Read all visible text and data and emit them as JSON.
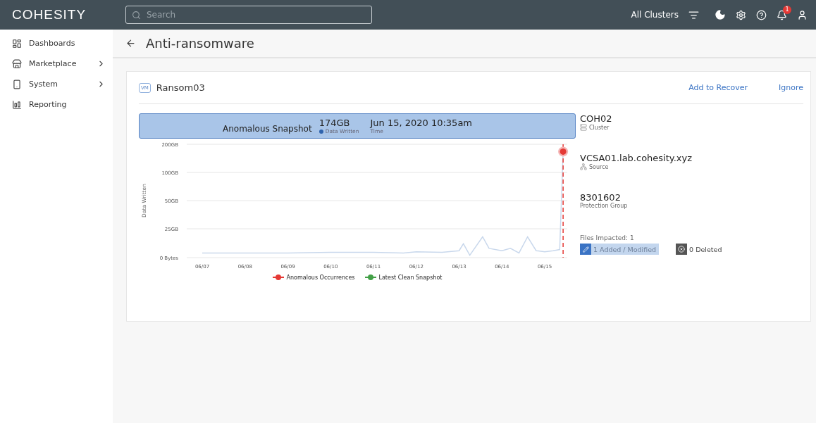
{
  "top_bar": {
    "logo": "COHESITY",
    "search": {
      "placeholder": "Search"
    },
    "cluster_filter": "All Clusters",
    "notification_count": "1"
  },
  "sidebar": {
    "items": [
      {
        "label": "Dashboards",
        "has_submenu": false
      },
      {
        "label": "Marketplace",
        "has_submenu": true
      },
      {
        "label": "System",
        "has_submenu": true
      },
      {
        "label": "Reporting",
        "has_submenu": false
      }
    ]
  },
  "page": {
    "title": "Anti-ransomware"
  },
  "card": {
    "object_type": "VM",
    "object_name": "Ransom03",
    "actions": [
      "Add to Recover",
      "Ignore"
    ],
    "banner": {
      "title": "Anomalous Snapshot",
      "data_written": "174GB",
      "data_written_label": "Data Written",
      "time": "Jun 15, 2020 10:35am",
      "time_label": "Time"
    },
    "chart": {
      "ylabel": "Data Written",
      "y_axis_labels": [
        "200GB",
        "100GB",
        "50GB",
        "25GB",
        "0 Bytes"
      ],
      "x_axis_labels": [
        "06/07",
        "06/08",
        "06/09",
        "06/10",
        "06/11",
        "06/12",
        "06/13",
        "06/14",
        "06/15"
      ]
    },
    "legend": [
      {
        "label": "Anomalous Occurrences",
        "color": "#e53935"
      },
      {
        "label": "Latest Clean Snapshot",
        "color": "#43a047"
      }
    ],
    "details": [
      {
        "value": "COH02",
        "label": "Cluster"
      },
      {
        "value": "VCSA01.lab.cohesity.xyz",
        "label": "Source"
      },
      {
        "value": "8301602",
        "label": "Protection Group"
      }
    ],
    "files_impacted": "Files Impacted: 1",
    "file_changes": [
      {
        "kind": "modified",
        "label": "1 Added / Modified"
      },
      {
        "kind": "deleted",
        "label": "0 Deleted"
      }
    ]
  }
}
